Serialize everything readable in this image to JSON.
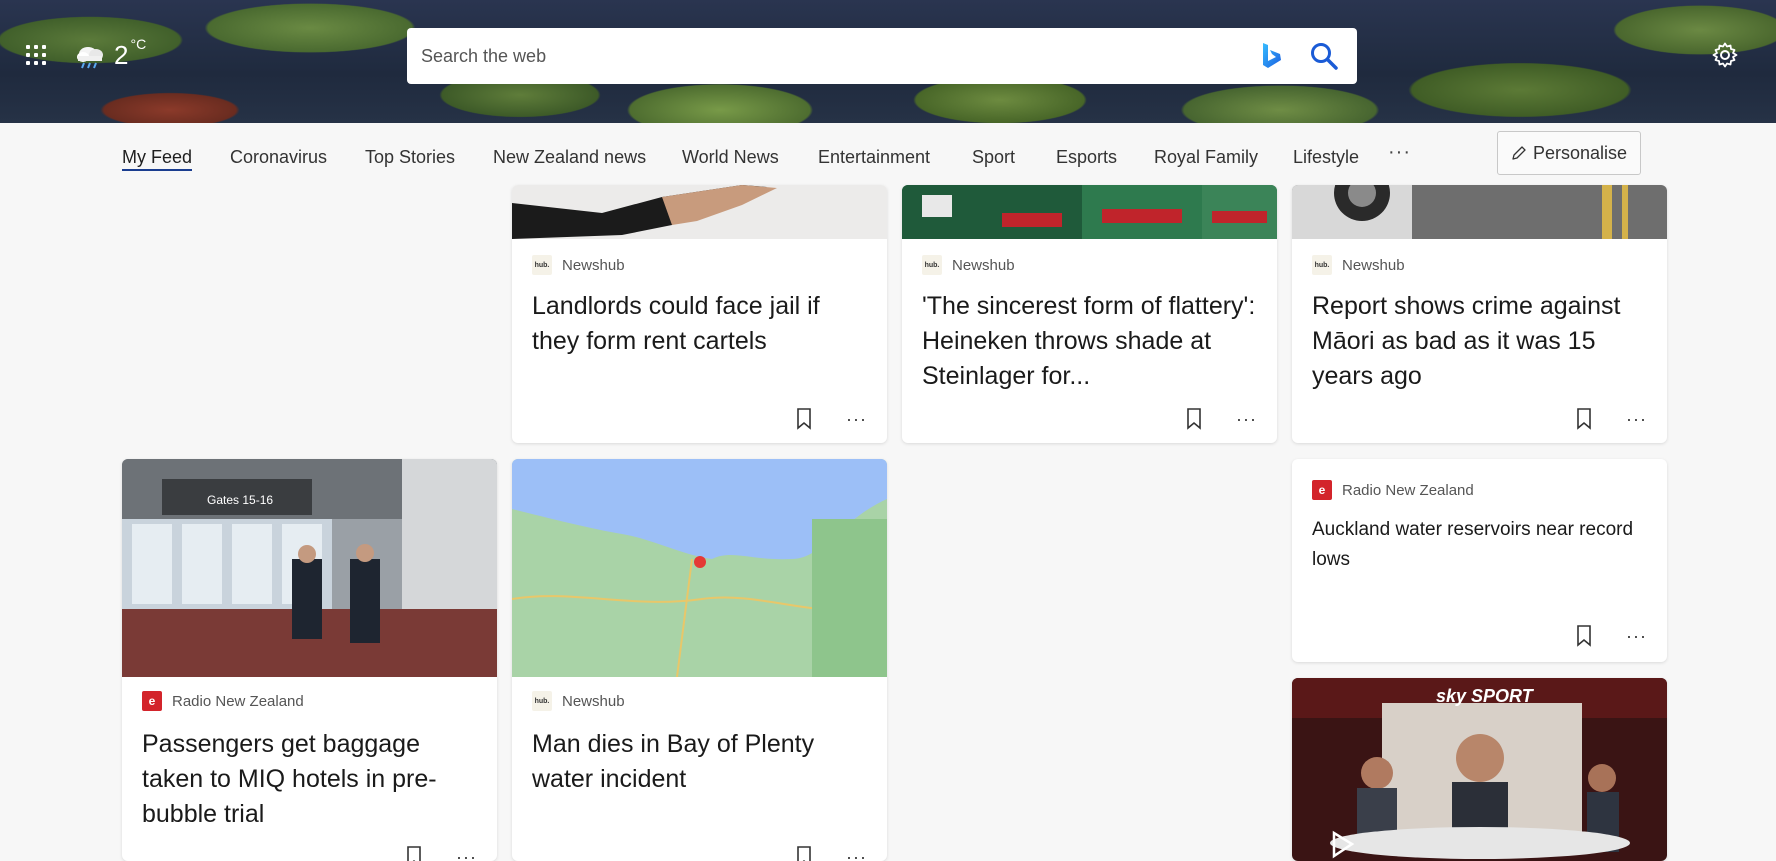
{
  "header": {
    "temperature": "2",
    "temperature_unit": "°C",
    "weather_icon": "cloud-rain-icon",
    "search_placeholder": "Search the web"
  },
  "nav": {
    "tabs": [
      {
        "label": "My Feed",
        "active": true
      },
      {
        "label": "Coronavirus"
      },
      {
        "label": "Top Stories"
      },
      {
        "label": "New Zealand news"
      },
      {
        "label": "World News"
      },
      {
        "label": "Entertainment"
      },
      {
        "label": "Sport"
      },
      {
        "label": "Esports"
      },
      {
        "label": "Royal Family"
      },
      {
        "label": "Lifestyle"
      }
    ],
    "more": "···",
    "personalise": "Personalise"
  },
  "cards": {
    "landlords": {
      "source": "Newshub",
      "headline": "Landlords could face jail if they form rent cartels"
    },
    "heineken": {
      "source": "Newshub",
      "headline": "'The sincerest form of flattery': Heineken throws shade at Steinlager for..."
    },
    "maori": {
      "source": "Newshub",
      "headline": "Report shows crime against Māori as bad as it was 15 years ago"
    },
    "reservoirs": {
      "source": "Radio New Zealand",
      "headline": "Auckland water reservoirs near record lows"
    },
    "baggage": {
      "source": "Radio New Zealand",
      "headline": "Passengers get baggage taken to MIQ hotels in pre-bubble trial",
      "image_sign": "Gates 15-16"
    },
    "bop": {
      "source": "Newshub",
      "headline": "Man dies in Bay of Plenty water incident"
    },
    "sky": {
      "brand": "sky SPORT"
    }
  },
  "logos": {
    "newshub": "hub.",
    "rnz": "e"
  },
  "more_label": "···",
  "colors": {
    "accent": "#1a3d8f",
    "rnz_red": "#d3242b",
    "bing_blue": "#1b87e6"
  }
}
